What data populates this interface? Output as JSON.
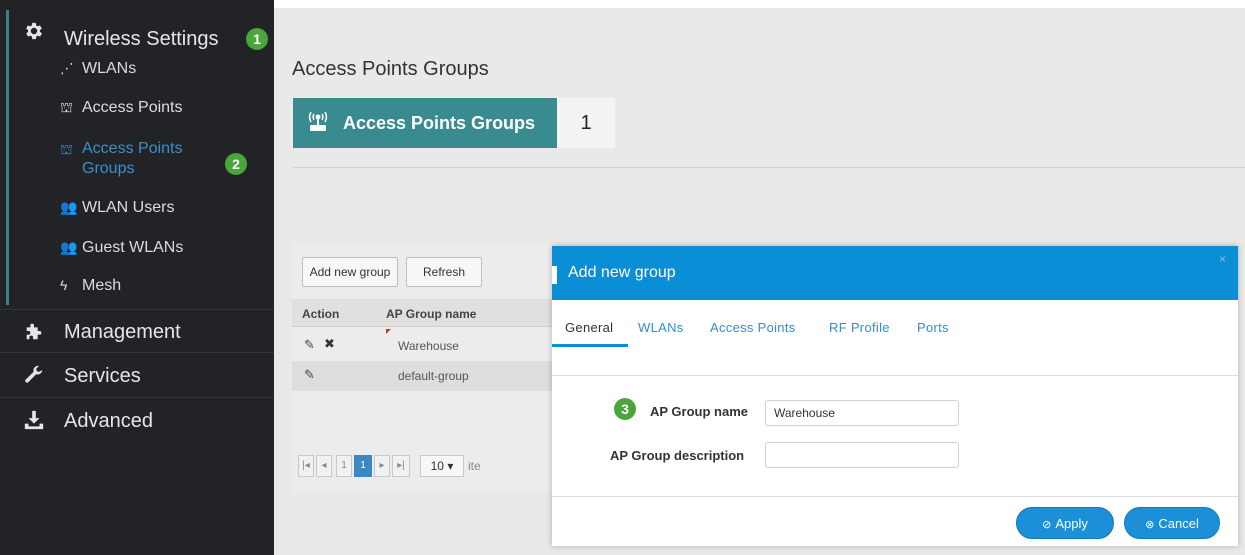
{
  "sidebar": {
    "sections": [
      {
        "label": "Wireless Settings",
        "icon": "gear-icon"
      },
      {
        "label": "Management",
        "icon": "puzzle-icon"
      },
      {
        "label": "Services",
        "icon": "wrench-icon"
      },
      {
        "label": "Advanced",
        "icon": "download-icon"
      }
    ],
    "items": [
      {
        "label": "WLANs",
        "icon": "wifi-icon"
      },
      {
        "label": "Access Points",
        "icon": "access-point-icon"
      },
      {
        "label": "Access Points Groups",
        "icon": "access-point-icon"
      },
      {
        "label": "WLAN Users",
        "icon": "users-icon"
      },
      {
        "label": "Guest WLANs",
        "icon": "users-icon"
      },
      {
        "label": "Mesh",
        "icon": "lightning-icon"
      }
    ],
    "active_color": "#3c90c9",
    "badges": {
      "step1": "1",
      "step2": "2"
    }
  },
  "main": {
    "title": "Access Points Groups",
    "stat": {
      "label": "Access Points Groups",
      "value": "1",
      "icon": "antenna-icon",
      "color": "#3a8b8f"
    },
    "buttons": {
      "add": "Add new group",
      "refresh": "Refresh"
    },
    "grid": {
      "columns": [
        "Action",
        "AP Group name"
      ],
      "rows": [
        {
          "name": "Warehouse"
        },
        {
          "name": "default-group"
        }
      ]
    },
    "pager": {
      "pages": [
        "1",
        "1"
      ],
      "page_size": "10",
      "page_size_suffix": "ite"
    }
  },
  "modal": {
    "title": "Add new group",
    "close": "×",
    "tabs": [
      "General",
      "WLANs",
      "Access Points",
      "RF Profile",
      "Ports"
    ],
    "active_tab": "General",
    "step3_badge": "3",
    "fields": {
      "name_label": "AP Group name",
      "name_value": "Warehouse",
      "desc_label": "AP Group description",
      "desc_value": ""
    },
    "buttons": {
      "apply": "Apply",
      "cancel": "Cancel"
    },
    "accent_color": "#0a8ed6"
  }
}
